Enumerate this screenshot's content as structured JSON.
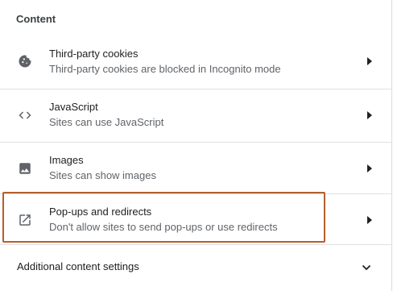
{
  "section": {
    "title": "Content"
  },
  "rows": [
    {
      "label": "Third-party cookies",
      "sub": "Third-party cookies are blocked in Incognito mode",
      "icon": "cookie-icon"
    },
    {
      "label": "JavaScript",
      "sub": "Sites can use JavaScript",
      "icon": "code-icon"
    },
    {
      "label": "Images",
      "sub": "Sites can show images",
      "icon": "image-icon"
    },
    {
      "label": "Pop-ups and redirects",
      "sub": "Don't allow sites to send pop-ups or use redirects",
      "icon": "open-in-new-icon"
    }
  ],
  "footer": {
    "label": "Additional content settings",
    "icon": "chevron-down-icon"
  },
  "colors": {
    "highlight": "#b45f2b",
    "icon": "#5f6368",
    "divider": "#e0e0e0"
  }
}
